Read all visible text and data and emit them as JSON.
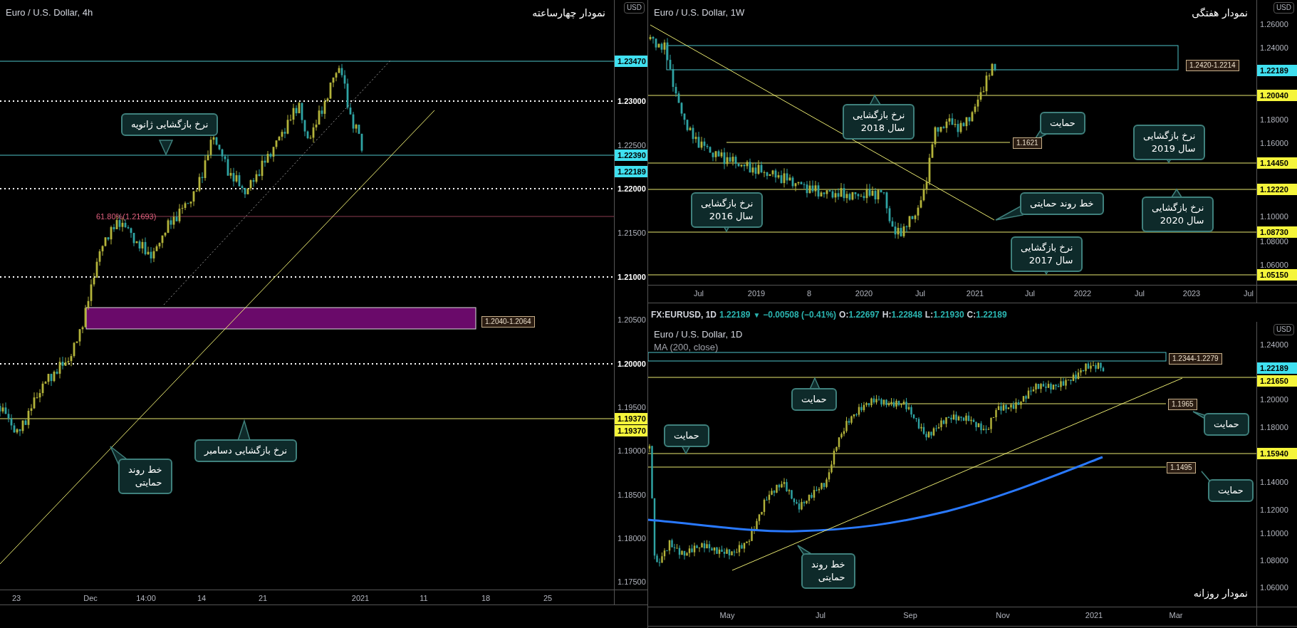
{
  "four_hour_chart": {
    "title": "Euro / U.S. Dollar, 4h",
    "caption": "نمودار چهارساعته",
    "currency": "USD",
    "price_labels": [
      {
        "kind": "marker",
        "text": "1.23470",
        "color": "#40e0f0"
      },
      {
        "kind": "round",
        "text": "1.23000"
      },
      {
        "kind": "tick",
        "text": "1.22500"
      },
      {
        "kind": "marker",
        "text": "1.22390",
        "color": "#40e0f0"
      },
      {
        "kind": "marker",
        "text": "1.22189",
        "color": "#40e0f0"
      },
      {
        "kind": "round",
        "text": "1.22000"
      },
      {
        "kind": "tick",
        "text": "1.21500"
      },
      {
        "kind": "round",
        "text": "1.21000"
      },
      {
        "kind": "tick",
        "text": "1.20500"
      },
      {
        "kind": "round",
        "text": "1.20000"
      },
      {
        "kind": "tick",
        "text": "1.19500"
      },
      {
        "kind": "marker",
        "text": "1.19370",
        "color": "#f5f53b"
      },
      {
        "kind": "marker",
        "text": "1.19370",
        "color": "#f5f53b"
      },
      {
        "kind": "tick",
        "text": "1.19000"
      },
      {
        "kind": "tick",
        "text": "1.18500"
      },
      {
        "kind": "tick",
        "text": "1.18000"
      },
      {
        "kind": "tick",
        "text": "1.17500"
      }
    ],
    "time_labels": [
      "23",
      "Dec",
      "14:00",
      "14",
      "21",
      "2021",
      "11",
      "18",
      "25"
    ],
    "level_labels": [
      {
        "kind": "plain",
        "text": "61.80%(1.21693)"
      },
      {
        "kind": "boxed",
        "text": "1.2040-1.2064"
      }
    ],
    "callouts": [
      {
        "lines": [
          "نرخ بازگشایی ژانویه"
        ]
      },
      {
        "lines": [
          "نرخ بازگشایی دسامبر"
        ]
      },
      {
        "lines": [
          "خط روند",
          "حمایتی"
        ]
      }
    ]
  },
  "weekly_chart": {
    "title": "Euro / U.S. Dollar, 1W",
    "caption": "نمودار هفتگی",
    "currency": "USD",
    "price_labels": [
      {
        "kind": "tick",
        "text": "1.26000"
      },
      {
        "kind": "tick",
        "text": "1.24000"
      },
      {
        "kind": "marker",
        "text": "1.22189",
        "color": "#40e0f0"
      },
      {
        "kind": "marker",
        "text": "1.20040",
        "color": "#f5f53b"
      },
      {
        "kind": "tick",
        "text": "1.18000"
      },
      {
        "kind": "tick",
        "text": "1.16000"
      },
      {
        "kind": "marker",
        "text": "1.14450",
        "color": "#f5f53b"
      },
      {
        "kind": "marker",
        "text": "1.12220",
        "color": "#f5f53b"
      },
      {
        "kind": "tick",
        "text": "1.10000"
      },
      {
        "kind": "marker",
        "text": "1.08730",
        "color": "#f5f53b"
      },
      {
        "kind": "tick",
        "text": "1.08000"
      },
      {
        "kind": "tick",
        "text": "1.06000"
      },
      {
        "kind": "marker",
        "text": "1.05150",
        "color": "#f5f53b"
      }
    ],
    "time_labels": [
      "Jul",
      "2019",
      "8",
      "2020",
      "Jul",
      "2021",
      "Jul",
      "2022",
      "Jul",
      "2023",
      "Jul"
    ],
    "level_labels": [
      {
        "kind": "boxed",
        "text": "1.2420-1.2214"
      },
      {
        "kind": "boxed",
        "text": "1.1621"
      }
    ],
    "callouts": [
      {
        "lines": [
          "نرخ بازگشایی",
          "سال 2019"
        ]
      },
      {
        "lines": [
          "حمایت"
        ]
      },
      {
        "lines": [
          "نرخ بازگشایی",
          "سال 2018"
        ]
      },
      {
        "lines": [
          "نرخ بازگشایی",
          "سال 2020"
        ]
      },
      {
        "lines": [
          "خط روند حمایتی"
        ]
      },
      {
        "lines": [
          "نرخ بازگشایی",
          "سال 2016"
        ]
      },
      {
        "lines": [
          "نرخ بازگشایی",
          "سال 2017"
        ]
      }
    ]
  },
  "symbol_bar": {
    "symbol": "FX:EURUSD, 1D",
    "last": "1.22189",
    "arrow": "▼",
    "change": "−0.00508 (−0.41%)",
    "ohlc": [
      {
        "key": "O:",
        "value": "1.22697"
      },
      {
        "key": "H:",
        "value": "1.22848"
      },
      {
        "key": "L:",
        "value": "1.21930"
      },
      {
        "key": "C:",
        "value": "1.22189"
      }
    ]
  },
  "daily_chart": {
    "title": "Euro / U.S. Dollar, 1D",
    "indicator": "MA (200, close)",
    "caption": "نمودار روزانه",
    "currency": "USD",
    "price_labels": [
      {
        "kind": "tick",
        "text": "1.24000"
      },
      {
        "kind": "marker",
        "text": "1.22189",
        "color": "#40e0f0"
      },
      {
        "kind": "marker",
        "text": "1.21650",
        "color": "#f5f53b"
      },
      {
        "kind": "tick",
        "text": "1.20000"
      },
      {
        "kind": "tick",
        "text": "1.18000"
      },
      {
        "kind": "marker",
        "text": "1.15940",
        "color": "#f5f53b"
      },
      {
        "kind": "tick",
        "text": "1.14000"
      },
      {
        "kind": "tick",
        "text": "1.12000"
      },
      {
        "kind": "tick",
        "text": "1.10000"
      },
      {
        "kind": "tick",
        "text": "1.08000"
      },
      {
        "kind": "tick",
        "text": "1.06000"
      }
    ],
    "time_labels": [
      "May",
      "Jul",
      "Sep",
      "Nov",
      "2021",
      "Mar"
    ],
    "level_labels": [
      {
        "kind": "boxed",
        "text": "1.2344-1.2279"
      },
      {
        "kind": "boxed",
        "text": "1.1965"
      },
      {
        "kind": "boxed",
        "text": "1.1495"
      }
    ],
    "callouts": [
      {
        "lines": [
          "حمایت"
        ]
      },
      {
        "lines": [
          "حمایت"
        ]
      },
      {
        "lines": [
          "حمایت"
        ]
      },
      {
        "lines": [
          "حمایت"
        ]
      },
      {
        "lines": [
          "خط روند",
          "حمایتی"
        ]
      }
    ]
  }
}
